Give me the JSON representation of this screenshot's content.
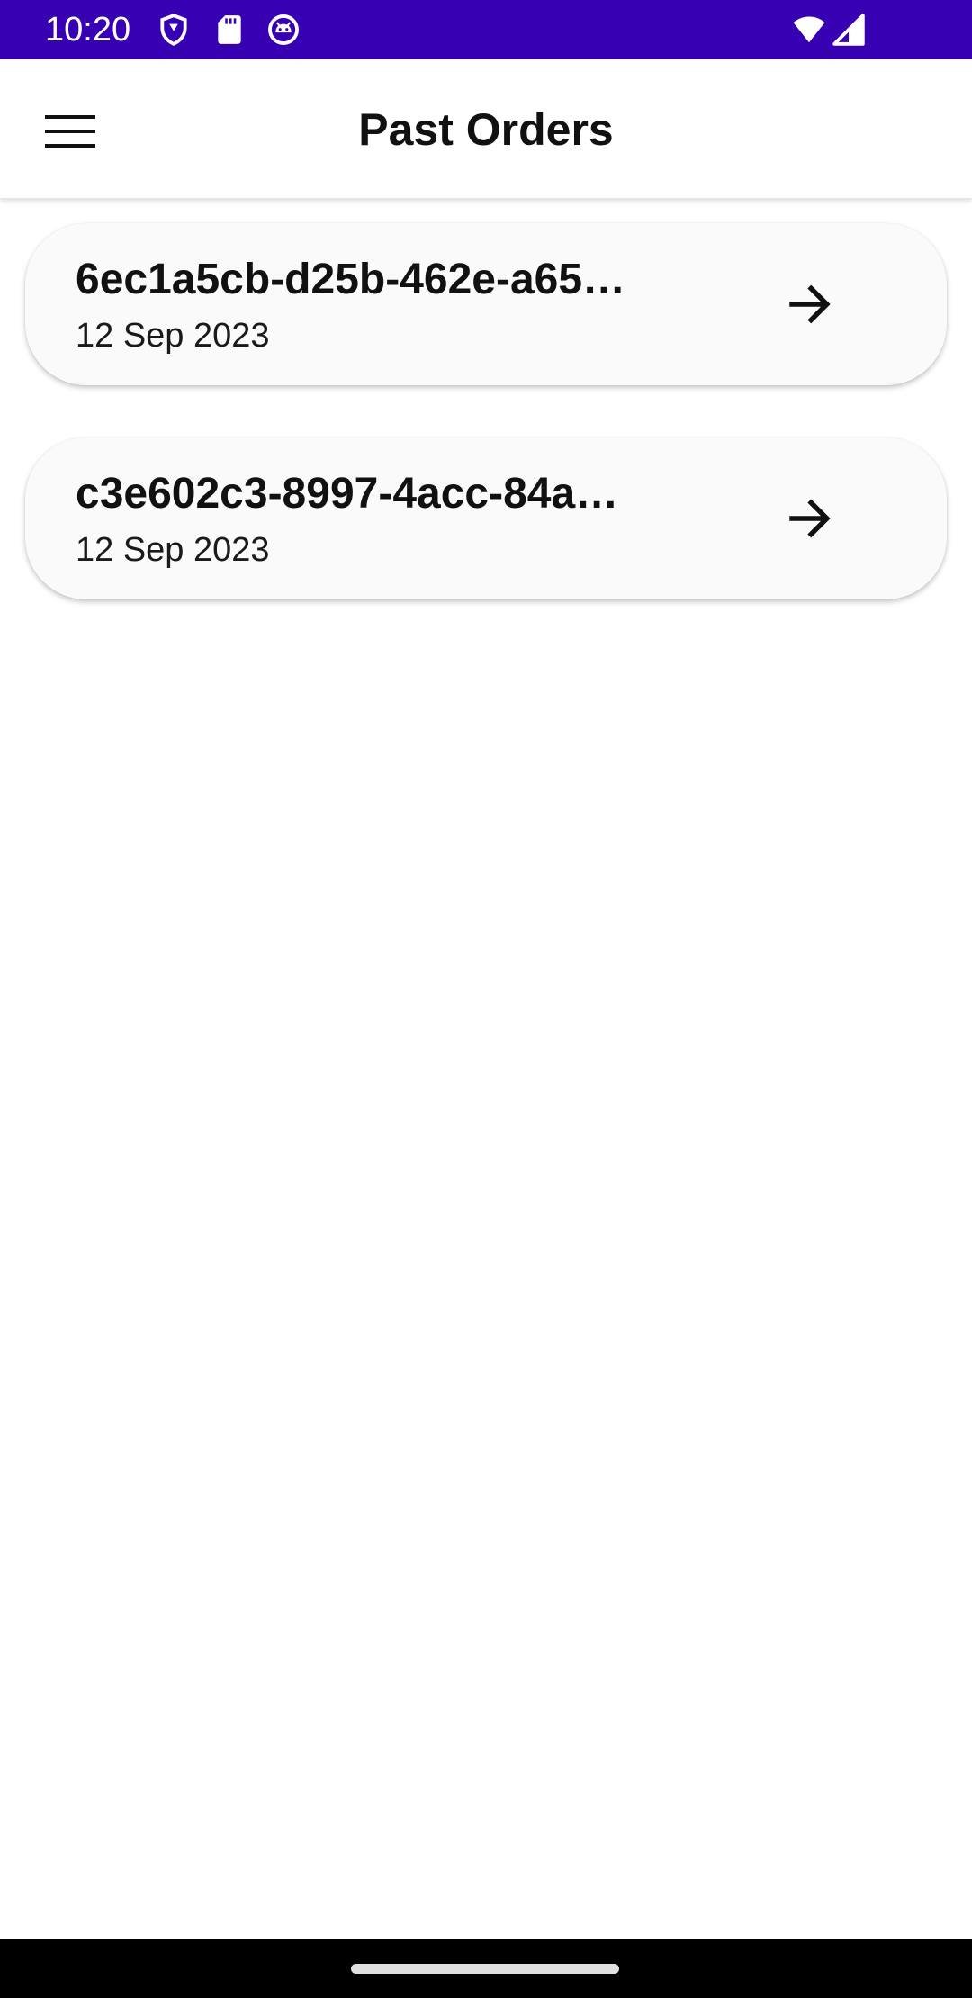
{
  "status_bar": {
    "time": "10:20",
    "background": "#3700b3",
    "icons_left": [
      "shield-icon",
      "sd-card-icon",
      "android-face-icon"
    ],
    "icons_right": [
      "wifi-icon",
      "cellular-signal-icon"
    ]
  },
  "app_bar": {
    "title": "Past Orders",
    "menu_icon": "hamburger-menu-icon"
  },
  "orders": [
    {
      "id": "6ec1a5cb-d25b-462e-a65…",
      "date": "12 Sep 2023",
      "action_icon": "arrow-right-icon"
    },
    {
      "id": "c3e602c3-8997-4acc-84a…",
      "date": "12 Sep 2023",
      "action_icon": "arrow-right-icon"
    }
  ],
  "nav_bar": {
    "background": "#000000",
    "indicator": "home-gesture-bar"
  }
}
